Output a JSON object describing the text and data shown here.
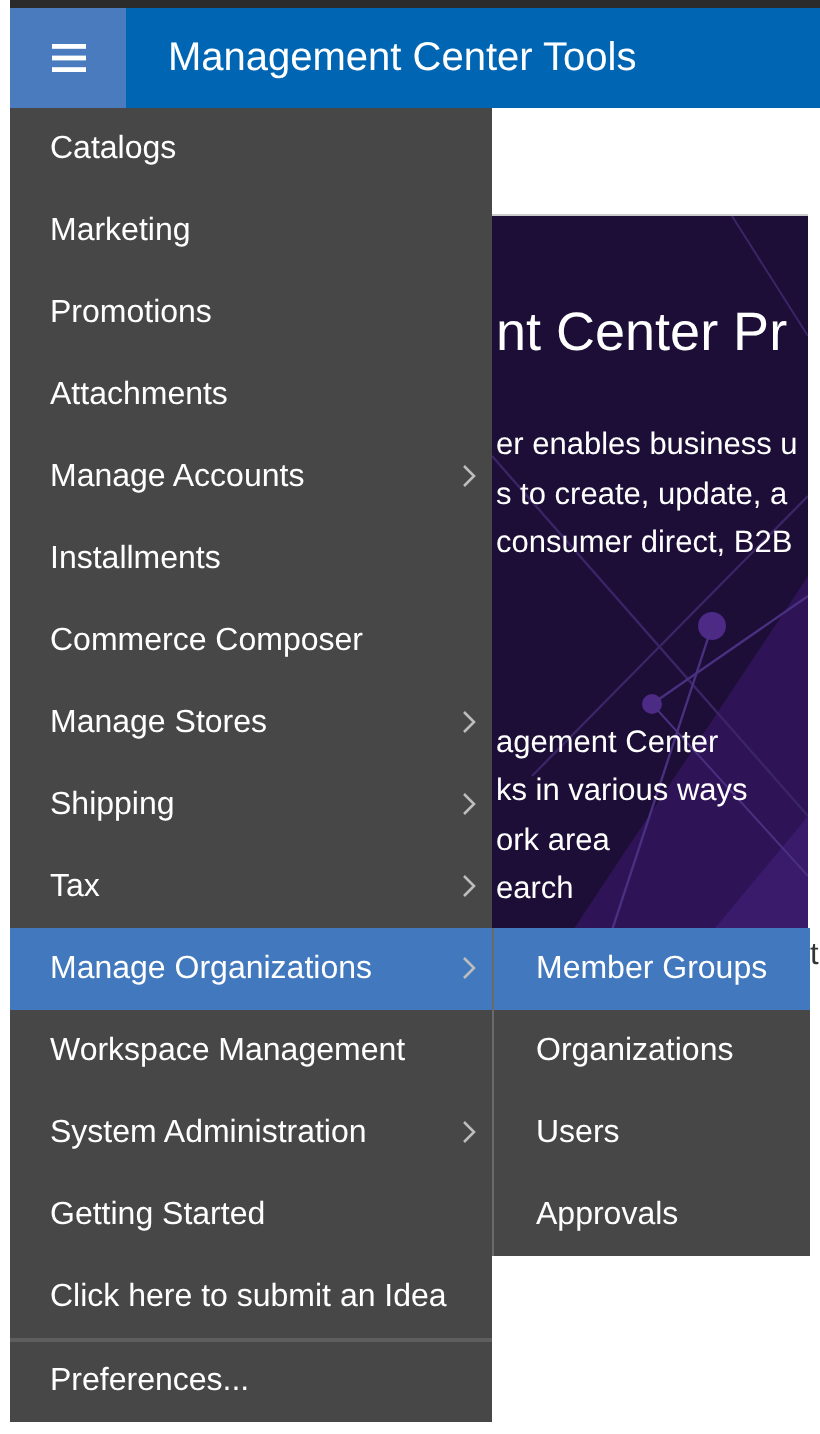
{
  "header": {
    "title": "Management Center Tools"
  },
  "banner": {
    "heading": "nt Center Pr",
    "paragraph": [
      "er enables business u",
      "s to create, update, a",
      "consumer direct, B2B"
    ],
    "list": [
      "agement Center",
      "ks in various ways",
      "ork area",
      "earch"
    ]
  },
  "stray_text": "t",
  "menu": {
    "items": [
      {
        "label": "Catalogs",
        "has_submenu": false,
        "selected": false
      },
      {
        "label": "Marketing",
        "has_submenu": false,
        "selected": false
      },
      {
        "label": "Promotions",
        "has_submenu": false,
        "selected": false
      },
      {
        "label": "Attachments",
        "has_submenu": false,
        "selected": false
      },
      {
        "label": "Manage Accounts",
        "has_submenu": true,
        "selected": false
      },
      {
        "label": "Installments",
        "has_submenu": false,
        "selected": false
      },
      {
        "label": "Commerce Composer",
        "has_submenu": false,
        "selected": false
      },
      {
        "label": "Manage Stores",
        "has_submenu": true,
        "selected": false
      },
      {
        "label": "Shipping",
        "has_submenu": true,
        "selected": false
      },
      {
        "label": "Tax",
        "has_submenu": true,
        "selected": false
      },
      {
        "label": "Manage Organizations",
        "has_submenu": true,
        "selected": true
      },
      {
        "label": "Workspace Management",
        "has_submenu": false,
        "selected": false
      },
      {
        "label": "System Administration",
        "has_submenu": true,
        "selected": false
      },
      {
        "label": "Getting Started",
        "has_submenu": false,
        "selected": false
      },
      {
        "label": "Click here to submit an Idea",
        "has_submenu": false,
        "selected": false
      }
    ],
    "footer_item": "Preferences..."
  },
  "submenu": {
    "items": [
      {
        "label": "Member Groups",
        "selected": true
      },
      {
        "label": "Organizations",
        "selected": false
      },
      {
        "label": "Users",
        "selected": false
      },
      {
        "label": "Approvals",
        "selected": false
      }
    ]
  }
}
